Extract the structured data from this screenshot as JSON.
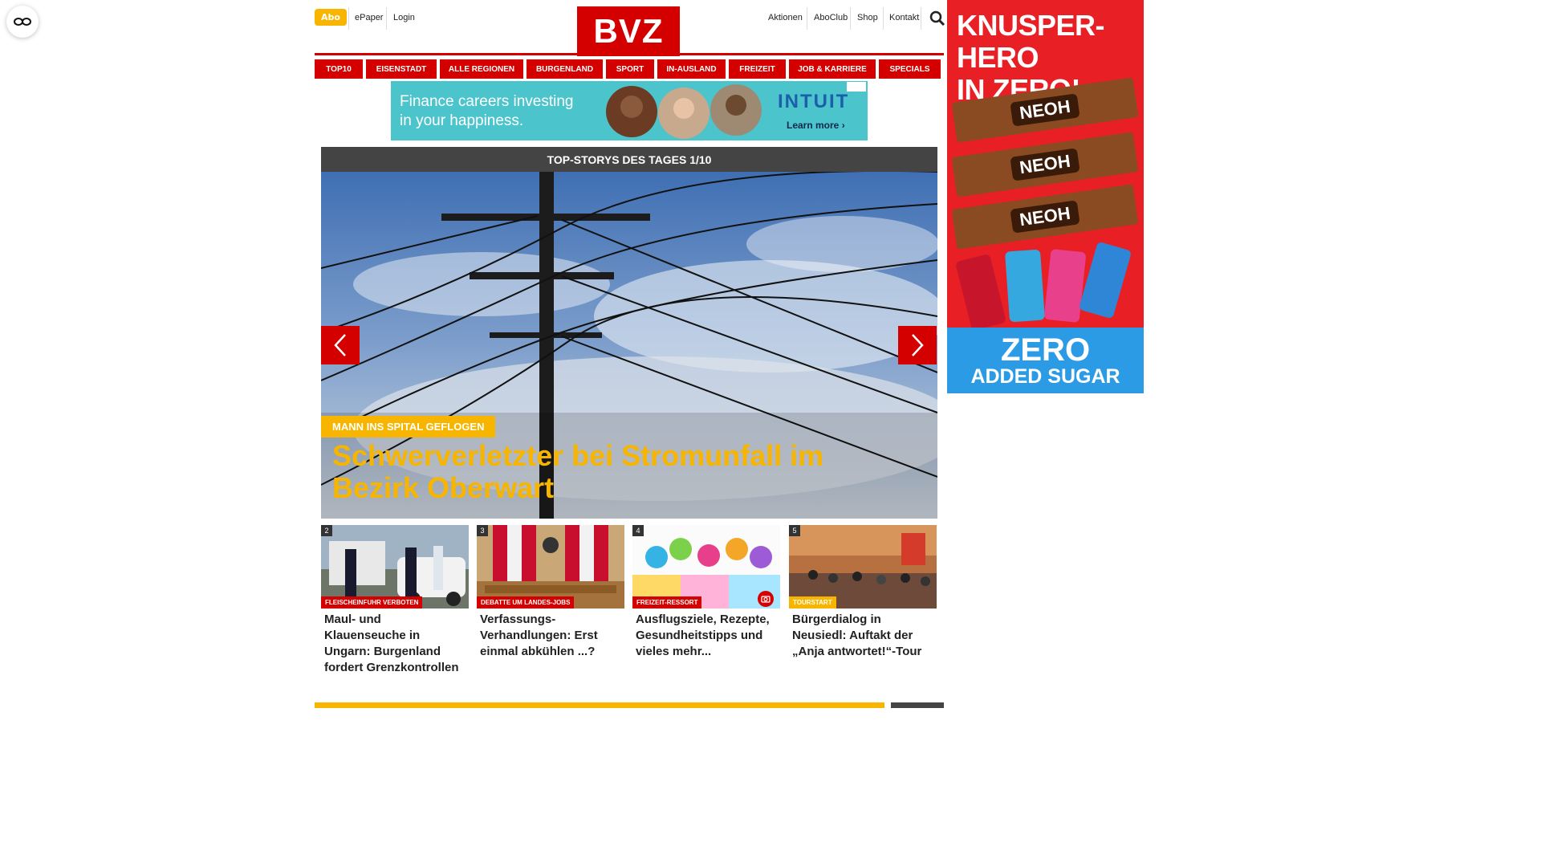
{
  "header": {
    "abo": "Abo",
    "epaper": "ePaper",
    "login": "Login",
    "logo": "BVZ",
    "right_links": [
      "Aktionen",
      "AboClub",
      "Shop",
      "Kontakt"
    ],
    "search_icon": "search-icon"
  },
  "nav": [
    "TOP10",
    "EISENSTADT",
    "ALLE REGIONEN",
    "BURGENLAND",
    "SPORT",
    "IN-AUSLAND",
    "FREIZEIT",
    "JOB & KARRIERE",
    "SPECIALS"
  ],
  "ad_banner": {
    "line1": "Finance careers investing",
    "line2": "in your happiness.",
    "brand": "INTUIT",
    "cta": "Learn more ›"
  },
  "hero": {
    "header": "TOP-STORYS DES TAGES 1/10",
    "kicker": "MANN INS SPITAL GEFLOGEN",
    "title": "Schwerverletzter bei Stromunfall im Bezirk Oberwart"
  },
  "cards": [
    {
      "num": "2",
      "tag": "FLEISCHEINFUHR VERBOTEN",
      "title": "Maul- und Klauenseuche in Ungarn: Burgenland fordert Grenzkontrollen",
      "tag_color": "#d40000"
    },
    {
      "num": "3",
      "tag": "DEBATTE UM LANDES-JOBS",
      "title": "Verfassungs-Verhandlungen: Erst einmal abkühlen ...?",
      "tag_color": "#d40000"
    },
    {
      "num": "4",
      "tag": "FREIZEIT-RESSORT",
      "title": "Ausflugsziele, Rezepte, Gesundheitstipps und vieles mehr...",
      "tag_color": "#d40000"
    },
    {
      "num": "5",
      "tag": "TOURSTART",
      "title": "Bürgerdialog in Neusiedl: Auftakt der „Anja antwortet!“-Tour",
      "tag_color": "#f7b500"
    }
  ],
  "side_ad": {
    "line1": "KNUSPER-HERO",
    "line2": "IN ZERO!",
    "bar_label": "NEOH",
    "zero": "ZERO",
    "sugar": "ADDED SUGAR"
  },
  "colors": {
    "brand_red": "#d40000",
    "accent_yellow": "#f7b500"
  }
}
